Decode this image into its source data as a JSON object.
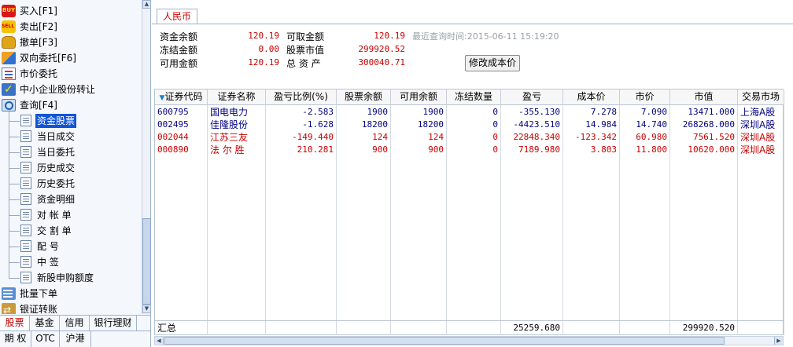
{
  "nav": {
    "top_items": [
      {
        "label": "买入[F1]",
        "icon": "buy-icon"
      },
      {
        "label": "卖出[F2]",
        "icon": "sell-icon"
      },
      {
        "label": "撤单[F3]",
        "icon": "hand-icon"
      },
      {
        "label": "双向委托[F6]",
        "icon": "dual-order-icon"
      },
      {
        "label": "市价委托",
        "icon": "market-order-icon"
      },
      {
        "label": "中小企业股份转让",
        "icon": "checkmark-icon"
      },
      {
        "label": "查询[F4]",
        "icon": "query-icon"
      }
    ],
    "query_items": [
      "资金股票",
      "当日成交",
      "当日委托",
      "历史成交",
      "历史委托",
      "资金明细",
      "对 帐 单",
      "交 割 单",
      "配     号",
      "中     签",
      "新股申购额度"
    ],
    "selected_query_item": "资金股票",
    "bottom_items": [
      {
        "label": "批量下单",
        "icon": "batch-order-icon"
      },
      {
        "label": "银证转账",
        "icon": "bank-transfer-icon"
      }
    ],
    "tabs_row1": [
      "股票",
      "基金",
      "信用",
      "银行理财"
    ],
    "tabs_row2": [
      "期 权",
      "OTC",
      "沪港"
    ],
    "active_tab": "股票",
    "scroll_up": "▲",
    "scroll_down": "▼"
  },
  "currency_tab": "人民币",
  "summary": {
    "balance_label": "资金余额",
    "balance": "120.19",
    "withdrawable_label": "可取金额",
    "withdrawable": "120.19",
    "query_time_label": "最近查询时间:2015-06-11 15:19:20",
    "frozen_label": "冻结金额",
    "frozen": "0.00",
    "market_value_label": "股票市值",
    "market_value": "299920.52",
    "available_label": "可用金额",
    "available": "120.19",
    "total_assets_label": "总 资 产",
    "total_assets": "300040.71"
  },
  "modify_cost_button": "修改成本价",
  "grid": {
    "sort_arrow": "▼",
    "columns": [
      "证券代码",
      "证券名称",
      "盈亏比例(%)",
      "股票余额",
      "可用余额",
      "冻结数量",
      "盈亏",
      "成本价",
      "市价",
      "市值",
      "交易市场"
    ],
    "rows": [
      {
        "code": "600795",
        "name": "国电电力",
        "pnl_ratio": "-2.583",
        "balance": "1900",
        "available": "1900",
        "frozen": "0",
        "pnl": "-355.130",
        "cost": "7.278",
        "price": "7.090",
        "value": "13471.000",
        "market": "上海A股",
        "color": "#000080"
      },
      {
        "code": "002495",
        "name": "佳隆股份",
        "pnl_ratio": "-1.628",
        "balance": "18200",
        "available": "18200",
        "frozen": "0",
        "pnl": "-4423.510",
        "cost": "14.984",
        "price": "14.740",
        "value": "268268.000",
        "market": "深圳A股",
        "color": "#000080"
      },
      {
        "code": "002044",
        "name": "江苏三友",
        "pnl_ratio": "-149.440",
        "balance": "124",
        "available": "124",
        "frozen": "0",
        "pnl": "22848.340",
        "cost": "-123.342",
        "price": "60.980",
        "value": "7561.520",
        "market": "深圳A股",
        "color": "#c80000"
      },
      {
        "code": "000890",
        "name": "法 尔 胜",
        "pnl_ratio": "210.281",
        "balance": "900",
        "available": "900",
        "frozen": "0",
        "pnl": "7189.980",
        "cost": "3.803",
        "price": "11.800",
        "value": "10620.000",
        "market": "深圳A股",
        "color": "#c80000"
      }
    ],
    "footer": {
      "label": "汇总",
      "pnl_total": "25259.680",
      "value_total": "299920.520"
    }
  },
  "hscroll": {
    "left": "◀",
    "right": "▶"
  }
}
